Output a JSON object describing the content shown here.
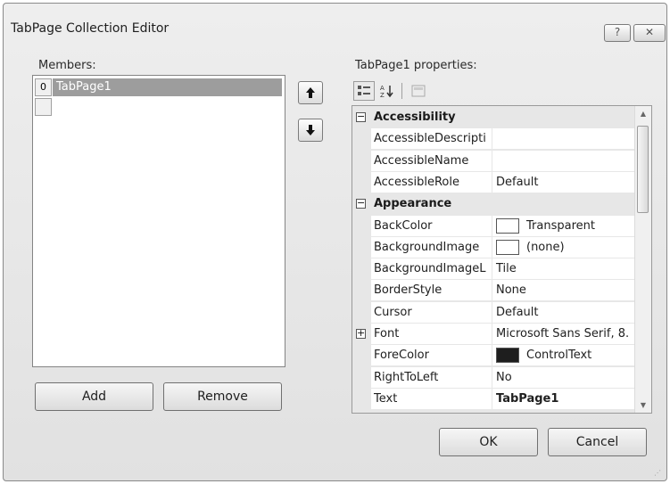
{
  "window": {
    "title": "TabPage Collection Editor",
    "help_glyph": "?",
    "close_glyph": "✕"
  },
  "members": {
    "label": "Members:",
    "items": [
      {
        "index": "0",
        "name": "TabPage1",
        "selected": true
      }
    ],
    "move_up_glyph": "🠉",
    "move_down_glyph": "🠋",
    "add_label": "Add",
    "remove_label": "Remove"
  },
  "properties": {
    "label": "TabPage1 properties:",
    "categories": [
      {
        "name": "Accessibility",
        "rows": [
          {
            "name": "AccessibleDescripti",
            "value": ""
          },
          {
            "name": "AccessibleName",
            "value": ""
          },
          {
            "name": "AccessibleRole",
            "value": "Default"
          }
        ]
      },
      {
        "name": "Appearance",
        "rows": [
          {
            "name": "BackColor",
            "value": "Transparent",
            "swatch": "#ffffff"
          },
          {
            "name": "BackgroundImage",
            "value": "(none)",
            "swatch": "#ffffff"
          },
          {
            "name": "BackgroundImageL",
            "value": "Tile"
          },
          {
            "name": "BorderStyle",
            "value": "None"
          },
          {
            "name": "Cursor",
            "value": "Default"
          },
          {
            "name": "Font",
            "value": "Microsoft Sans Serif, 8.",
            "expandable": true
          },
          {
            "name": "ForeColor",
            "value": "ControlText",
            "swatch": "#1e1e1e"
          },
          {
            "name": "RightToLeft",
            "value": "No"
          },
          {
            "name": "Text",
            "value": "TabPage1",
            "bold": true
          }
        ]
      }
    ]
  },
  "footer": {
    "ok_label": "OK",
    "cancel_label": "Cancel"
  },
  "icons": {
    "categorized": "categorized-icon",
    "alphabetical": "alphabetical-icon",
    "property_pages": "property-pages-icon"
  }
}
